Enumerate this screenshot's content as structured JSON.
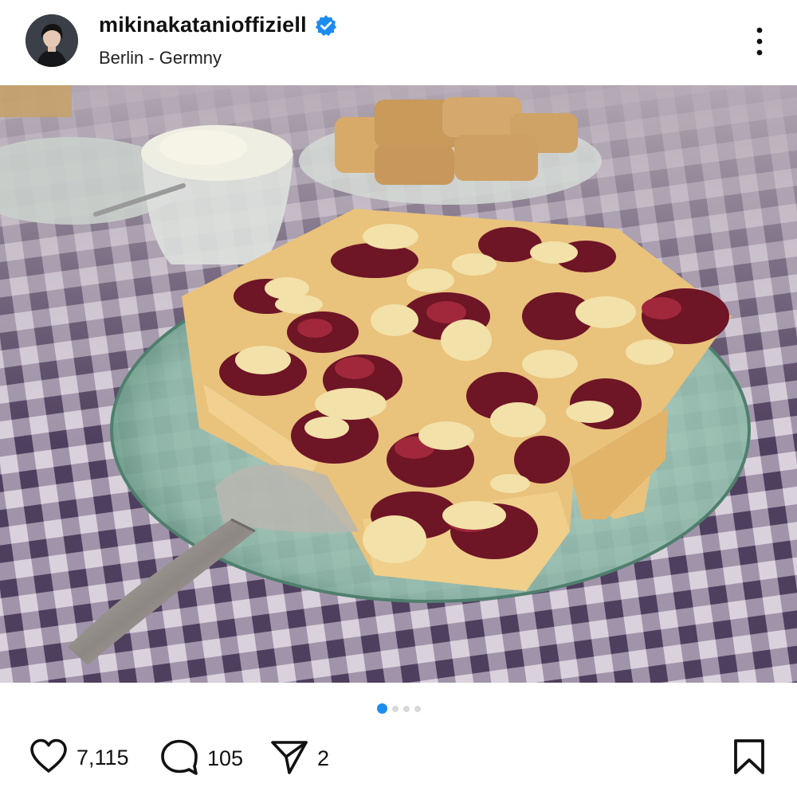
{
  "post": {
    "username": "mikinakatanioffiziell",
    "verified": true,
    "location": "Berlin - Germny",
    "image_alt": "Plum crumble cake slices on a glass plate with a cake server, on a purple gingham tablecloth",
    "carousel": {
      "total": 4,
      "active_index": 0
    }
  },
  "actions": {
    "likes": "7,115",
    "comments": "105",
    "shares": "2"
  },
  "icons": {
    "verified": "verified-badge-icon",
    "more": "more-vertical-icon",
    "like": "heart-icon",
    "comment": "comment-bubble-icon",
    "share": "paper-plane-icon",
    "save": "bookmark-icon"
  },
  "colors": {
    "accent": "#1d8cf0",
    "verified": "#1d8cf0",
    "text": "#111111"
  }
}
